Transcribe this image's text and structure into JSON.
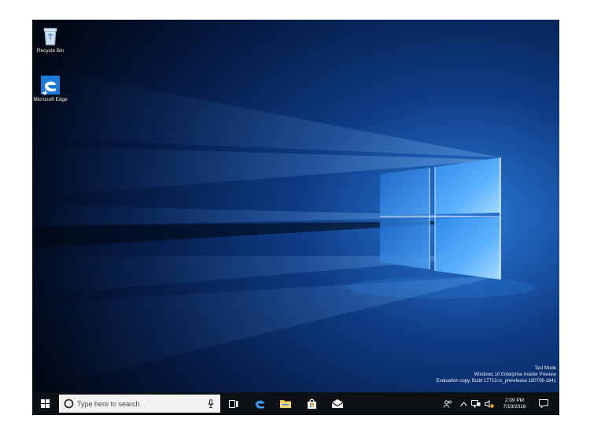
{
  "desktop": {
    "icons": [
      {
        "label": "Recycle Bin",
        "icon": "recycle-bin-icon"
      },
      {
        "label": "Microsoft Edge",
        "icon": "edge-icon"
      }
    ],
    "watermark": {
      "line1": "Test Mode",
      "line2": "Windows 10 Enterprise Insider Preview",
      "line3": "Evaluation copy. Build 17713.rs_prerelease.180706-1641"
    }
  },
  "taskbar": {
    "start_icon": "windows-start-icon",
    "search": {
      "placeholder": "Type here to search",
      "value": "",
      "mic_icon": "microphone-icon"
    },
    "pinned": [
      "task-view-icon",
      "edge-icon",
      "file-explorer-icon",
      "store-icon",
      "mail-icon"
    ],
    "tray": {
      "icons": [
        "people-icon",
        "chevron-up-icon",
        "network-icon",
        "volume-icon"
      ],
      "time": "2:09 PM",
      "date": "7/10/2018",
      "notification_icon": "action-center-icon"
    }
  },
  "colors": {
    "taskbar": "#0c1116",
    "wallpaper_dark": "#041024",
    "wallpaper_glow": "#5fb6ff",
    "search_box": "#f2f2f2"
  }
}
